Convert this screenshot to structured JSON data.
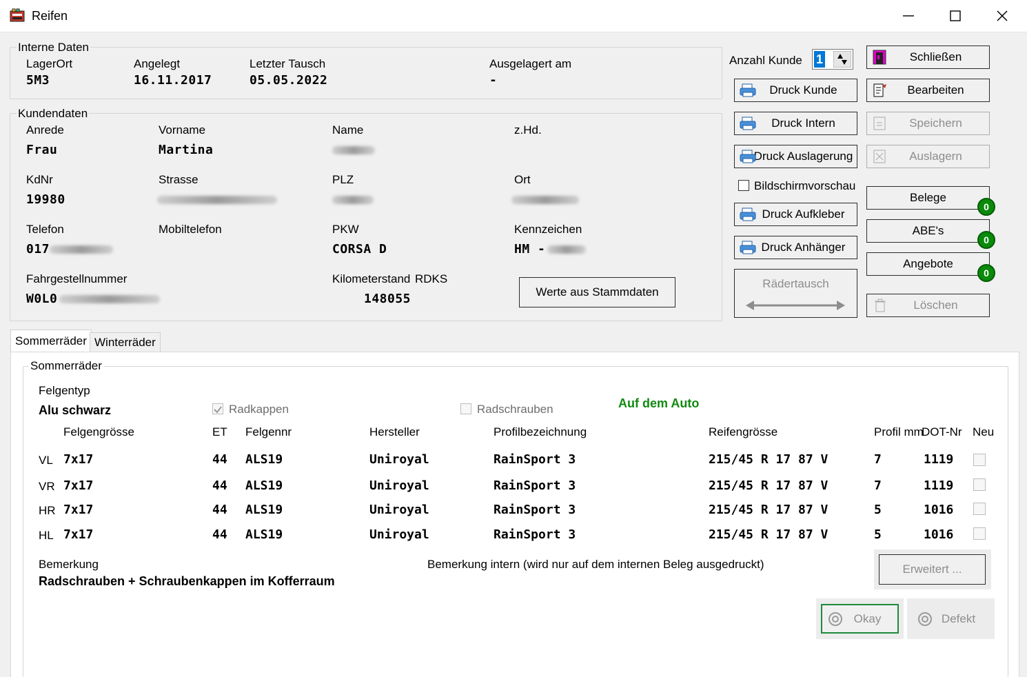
{
  "window": {
    "title": "Reifen"
  },
  "interne_daten": {
    "title": "Interne Daten",
    "lagerort_label": "LagerOrt",
    "lagerort": "5M3",
    "angelegt_label": "Angelegt",
    "angelegt": "16.11.2017",
    "letzter_tausch_label": "Letzter Tausch",
    "letzter_tausch": "05.05.2022",
    "ausgelagert_label": "Ausgelagert am",
    "ausgelagert": "-"
  },
  "kundendaten": {
    "title": "Kundendaten",
    "anrede_label": "Anrede",
    "anrede": "Frau",
    "vorname_label": "Vorname",
    "vorname": "Martina",
    "name_label": "Name",
    "zhd_label": "z.Hd.",
    "kdnr_label": "KdNr",
    "kdnr": "19980",
    "strasse_label": "Strasse",
    "plz_label": "PLZ",
    "ort_label": "Ort",
    "telefon_label": "Telefon",
    "telefon": "017",
    "mobil_label": "Mobiltelefon",
    "pkw_label": "PKW",
    "pkw": "CORSA D",
    "kennzeichen_label": "Kennzeichen",
    "kennzeichen": "HM -",
    "fgnr_label": "Fahrgestellnummer",
    "fgnr": "W0L0",
    "km_label": "Kilometerstand",
    "km": "148055",
    "rdks_label": "RDKS",
    "stammdaten_button": "Werte aus Stammdaten"
  },
  "actions": {
    "anzahl_kunde_label": "Anzahl Kunde",
    "anzahl_kunde": "1",
    "druck_kunde": "Druck Kunde",
    "druck_intern": "Druck Intern",
    "druck_auslagerung": "Druck Auslagerung",
    "bildschirmvorschau": "Bildschirmvorschau",
    "druck_aufkleber": "Druck Aufkleber",
    "druck_anhaenger": "Druck Anhänger",
    "raedertausch": "Rädertausch",
    "schliessen": "Schließen",
    "bearbeiten": "Bearbeiten",
    "speichern": "Speichern",
    "auslagern": "Auslagern",
    "belege": "Belege",
    "belege_count": "0",
    "abes": "ABE's",
    "abes_count": "0",
    "angebote": "Angebote",
    "angebote_count": "0",
    "loeschen": "Löschen"
  },
  "tabs": [
    {
      "label": "Sommerräder"
    },
    {
      "label": "Winterräder"
    }
  ],
  "sommer": {
    "title": "Sommerräder",
    "felgentyp_label": "Felgentyp",
    "felgentyp": "Alu schwarz",
    "radkappen": "Radkappen",
    "radschrauben": "Radschrauben",
    "status": "Auf dem Auto",
    "headers": {
      "felgengroesse": "Felgengrösse",
      "et": "ET",
      "felgennr": "Felgennr",
      "hersteller": "Hersteller",
      "profil": "Profilbezeichnung",
      "reifengroesse": "Reifengrösse",
      "profilmm": "Profil mm",
      "dot": "DOT-Nr",
      "neu": "Neu"
    },
    "rows": [
      {
        "pos": "VL",
        "felge": "7x17",
        "et": "44",
        "felgennr": "ALS19",
        "hersteller": "Uniroyal",
        "profil": "RainSport 3",
        "reifen": "215/45 R 17 87 V",
        "mm": "7",
        "dot": "1119"
      },
      {
        "pos": "VR",
        "felge": "7x17",
        "et": "44",
        "felgennr": "ALS19",
        "hersteller": "Uniroyal",
        "profil": "RainSport 3",
        "reifen": "215/45 R 17 87 V",
        "mm": "7",
        "dot": "1119"
      },
      {
        "pos": "HR",
        "felge": "7x17",
        "et": "44",
        "felgennr": "ALS19",
        "hersteller": "Uniroyal",
        "profil": "RainSport 3",
        "reifen": "215/45 R 17 87 V",
        "mm": "5",
        "dot": "1016"
      },
      {
        "pos": "HL",
        "felge": "7x17",
        "et": "44",
        "felgennr": "ALS19",
        "hersteller": "Uniroyal",
        "profil": "RainSport 3",
        "reifen": "215/45 R 17 87 V",
        "mm": "5",
        "dot": "1016"
      }
    ],
    "bemerkung_label": "Bemerkung",
    "bemerkung": "Radschrauben + Schraubenkappen im Kofferraum",
    "bemerkung_intern_label": "Bemerkung intern (wird nur auf dem internen Beleg ausgedruckt)",
    "erweitert": "Erweitert ...",
    "okay": "Okay",
    "defekt": "Defekt"
  }
}
